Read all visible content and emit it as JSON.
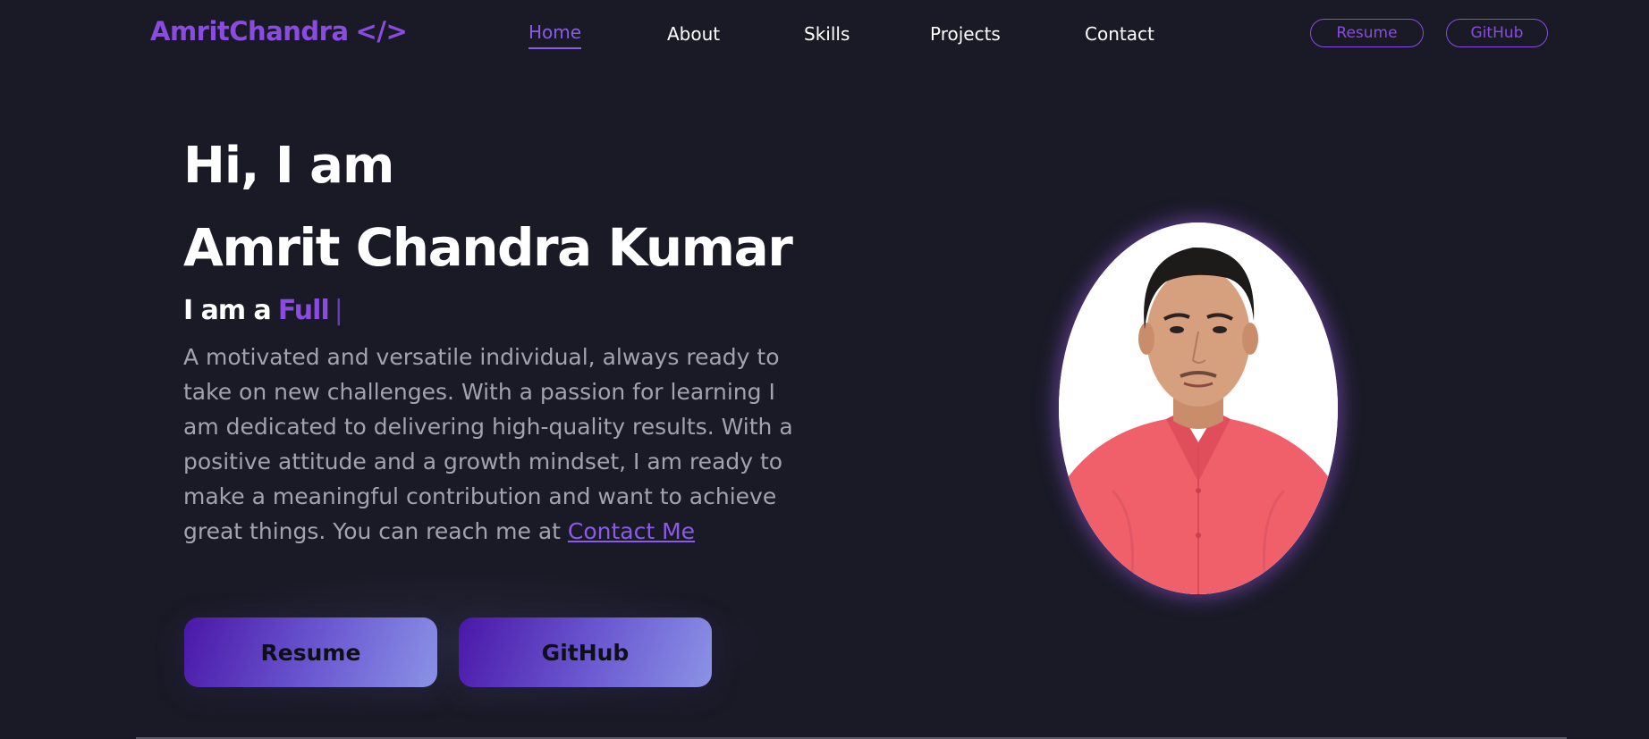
{
  "nav": {
    "logo_text": "AmritChandra",
    "logo_code": "</>",
    "links": [
      {
        "label": "Home",
        "active": true
      },
      {
        "label": "About",
        "active": false
      },
      {
        "label": "Skills",
        "active": false
      },
      {
        "label": "Projects",
        "active": false
      },
      {
        "label": "Contact",
        "active": false
      }
    ],
    "resume_label": "Resume",
    "github_label": "GitHub"
  },
  "hero": {
    "greeting": "Hi, I am",
    "name": "Amrit Chandra Kumar",
    "role_prefix": "I am a",
    "role_typed": "Full",
    "role_cursor": "|",
    "description": "A motivated and versatile individual, always ready to take on new challenges. With a passion for learning I am dedicated to delivering high-quality results. With a positive attitude and a growth mindset, I am ready to make a meaningful contribution and want to achieve great things. You can reach me at",
    "contact_link": "Contact Me",
    "resume_button": "Resume",
    "github_button": "GitHub"
  },
  "colors": {
    "background": "#1a1a27",
    "accent": "#8a4bdf",
    "text_muted": "#a3a3b0",
    "button_gradient_start": "#4a17a8",
    "button_gradient_end": "#8b93e6",
    "avatar_shirt": "#f0606a"
  }
}
